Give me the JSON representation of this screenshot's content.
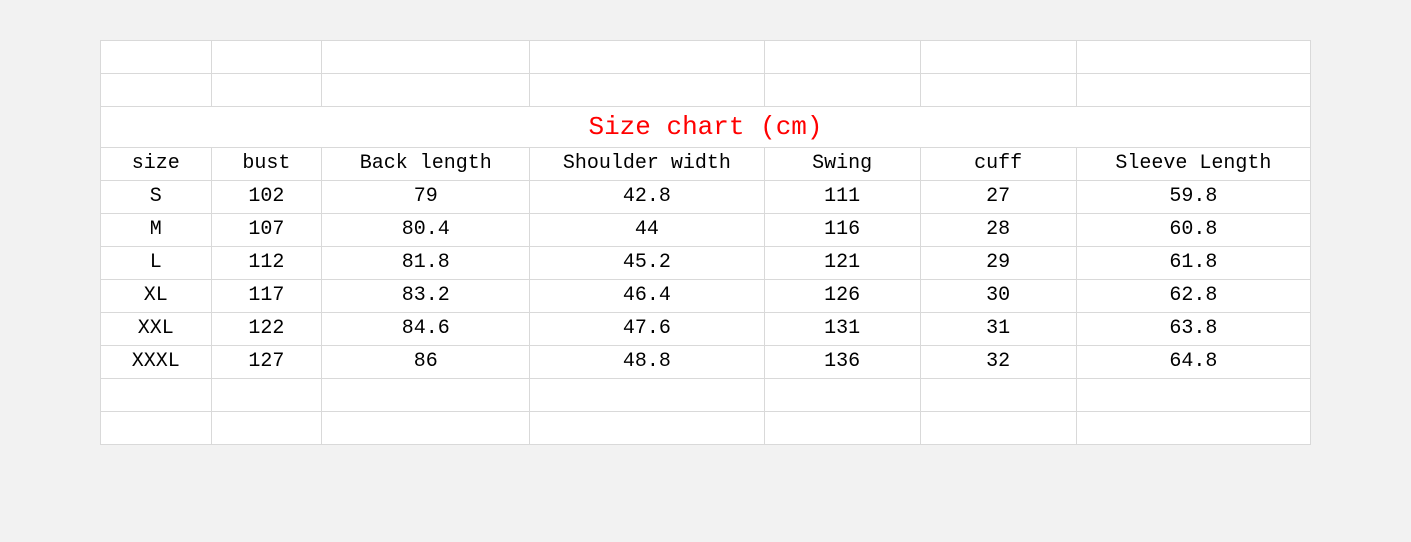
{
  "title": "Size chart (cm)",
  "columns": [
    "size",
    "bust",
    "Back length",
    "Shoulder width",
    "Swing",
    "cuff",
    "Sleeve Length"
  ],
  "rows": [
    [
      "S",
      "102",
      "79",
      "42.8",
      "111",
      "27",
      "59.8"
    ],
    [
      "M",
      "107",
      "80.4",
      "44",
      "116",
      "28",
      "60.8"
    ],
    [
      "L",
      "112",
      "81.8",
      "45.2",
      "121",
      "29",
      "61.8"
    ],
    [
      "XL",
      "117",
      "83.2",
      "46.4",
      "126",
      "30",
      "62.8"
    ],
    [
      "XXL",
      "122",
      "84.6",
      "47.6",
      "131",
      "31",
      "63.8"
    ],
    [
      "XXXL",
      "127",
      "86",
      "48.8",
      "136",
      "32",
      "64.8"
    ]
  ],
  "chart_data": {
    "type": "table",
    "title": "Size chart (cm)",
    "columns": [
      "size",
      "bust",
      "Back length",
      "Shoulder width",
      "Swing",
      "cuff",
      "Sleeve Length"
    ],
    "rows": [
      {
        "size": "S",
        "bust": 102,
        "Back length": 79.0,
        "Shoulder width": 42.8,
        "Swing": 111,
        "cuff": 27,
        "Sleeve Length": 59.8
      },
      {
        "size": "M",
        "bust": 107,
        "Back length": 80.4,
        "Shoulder width": 44.0,
        "Swing": 116,
        "cuff": 28,
        "Sleeve Length": 60.8
      },
      {
        "size": "L",
        "bust": 112,
        "Back length": 81.8,
        "Shoulder width": 45.2,
        "Swing": 121,
        "cuff": 29,
        "Sleeve Length": 61.8
      },
      {
        "size": "XL",
        "bust": 117,
        "Back length": 83.2,
        "Shoulder width": 46.4,
        "Swing": 126,
        "cuff": 30,
        "Sleeve Length": 62.8
      },
      {
        "size": "XXL",
        "bust": 122,
        "Back length": 84.6,
        "Shoulder width": 47.6,
        "Swing": 131,
        "cuff": 31,
        "Sleeve Length": 63.8
      },
      {
        "size": "XXXL",
        "bust": 127,
        "Back length": 86.0,
        "Shoulder width": 48.8,
        "Swing": 136,
        "cuff": 32,
        "Sleeve Length": 64.8
      }
    ]
  }
}
